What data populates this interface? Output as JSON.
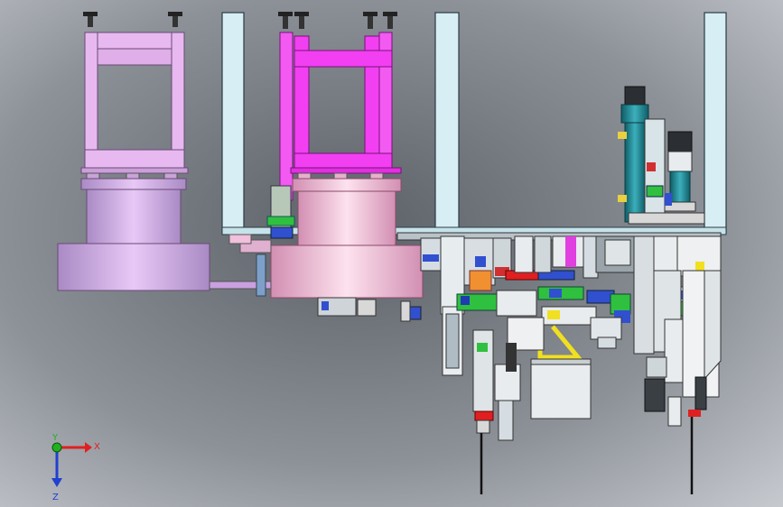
{
  "triad": {
    "x_label": "X",
    "y_label": "Y",
    "z_label": "Z",
    "colors": {
      "x": "#e02020",
      "y": "#20b020",
      "z": "#2040d0"
    }
  },
  "colors": {
    "background_dark": "#5c6168",
    "background_light": "#d4d8dd",
    "frame": "#d6eef4",
    "fixture_light": "#e7b9f0",
    "fixture_magenta": "#f23ff2",
    "turntable_light": "#c9a0e0",
    "turntable_pink": "#f0b8d6",
    "motor_teal": "#208a96",
    "module_blue": "#3050d0",
    "module_green": "#30c040",
    "module_red": "#e02020",
    "module_yellow": "#f0e020",
    "module_orange": "#f09030",
    "module_gray": "#d8d8d8"
  }
}
